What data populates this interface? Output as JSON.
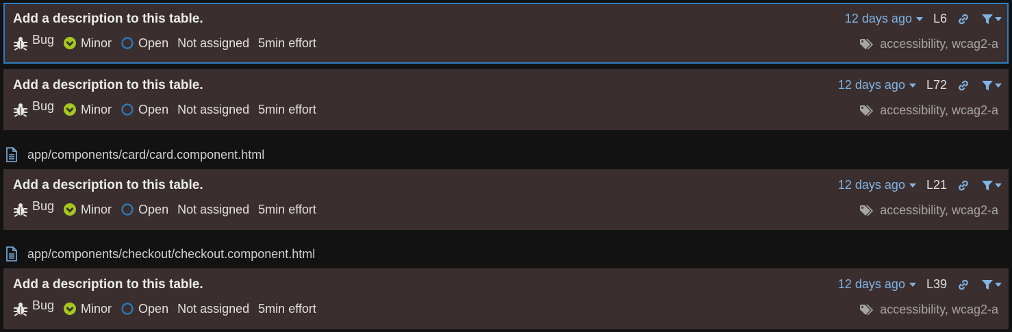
{
  "colors": {
    "accent": "#2a7fc0",
    "link": "#7fb5e6",
    "minor": "#a5c81e",
    "open": "#2a7fc0",
    "card_bg": "#3b2e2e",
    "page_bg": "#121212"
  },
  "files": [
    {
      "path": "app/components/card/card.component.html"
    },
    {
      "path": "app/components/checkout/checkout.component.html"
    }
  ],
  "issues": [
    {
      "message": "Add a description to this table.",
      "type": "Bug",
      "severity": "Minor",
      "status": "Open",
      "assignee": "Not assigned",
      "effort": "5min effort",
      "date": "12 days ago",
      "line": "L6",
      "tags": "accessibility, wcag2-a",
      "selected": true
    },
    {
      "message": "Add a description to this table.",
      "type": "Bug",
      "severity": "Minor",
      "status": "Open",
      "assignee": "Not assigned",
      "effort": "5min effort",
      "date": "12 days ago",
      "line": "L72",
      "tags": "accessibility, wcag2-a",
      "selected": false
    },
    {
      "message": "Add a description to this table.",
      "type": "Bug",
      "severity": "Minor",
      "status": "Open",
      "assignee": "Not assigned",
      "effort": "5min effort",
      "date": "12 days ago",
      "line": "L21",
      "tags": "accessibility, wcag2-a",
      "selected": false
    },
    {
      "message": "Add a description to this table.",
      "type": "Bug",
      "severity": "Minor",
      "status": "Open",
      "assignee": "Not assigned",
      "effort": "5min effort",
      "date": "12 days ago",
      "line": "L39",
      "tags": "accessibility, wcag2-a",
      "selected": false
    }
  ]
}
